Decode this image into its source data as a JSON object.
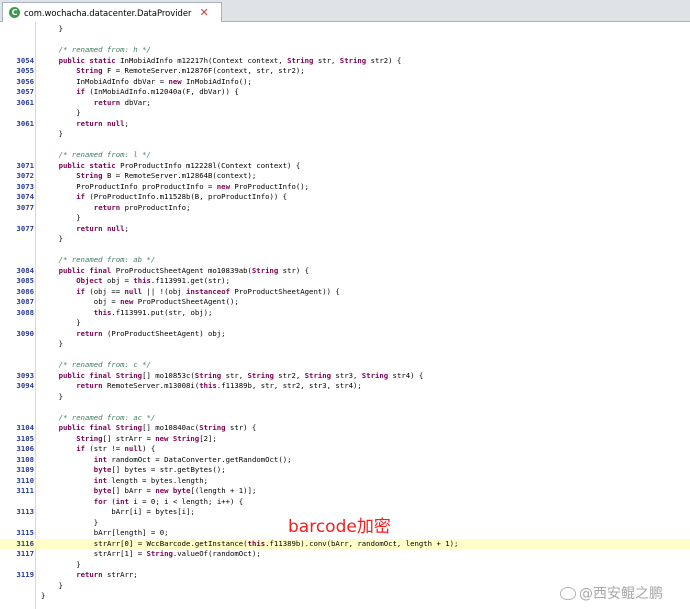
{
  "tab": {
    "title": "com.wochacha.datacenter.DataProvider",
    "icon": "class-icon",
    "close_icon": "close-icon"
  },
  "annotation": "barcode加密",
  "watermark": "@西安鲲之鹏",
  "colors": {
    "keyword": "#7f0055",
    "comment": "#3f7f5f",
    "string": "#2a00ff",
    "line_number": "#2a3a9c",
    "highlight": "#ffffc8",
    "annotation": "#ff1a1a"
  },
  "lines": [
    {
      "ln": "",
      "indent": 4,
      "tokens": [
        [
          "p",
          "}"
        ]
      ]
    },
    {
      "ln": "",
      "indent": 0,
      "tokens": []
    },
    {
      "ln": "",
      "indent": 4,
      "tokens": [
        [
          "c",
          "/* renamed from: h */"
        ]
      ]
    },
    {
      "ln": "3054",
      "indent": 4,
      "tokens": [
        [
          "k",
          "public static "
        ],
        [
          "p",
          "InMobiAdInfo m12217h(Context context, "
        ],
        [
          "k",
          "String "
        ],
        [
          "p",
          "str, "
        ],
        [
          "k",
          "String "
        ],
        [
          "p",
          "str2) {"
        ]
      ]
    },
    {
      "ln": "3055",
      "indent": 8,
      "tokens": [
        [
          "k",
          "String "
        ],
        [
          "p",
          "F = RemoteServer.m12876F(context, str, str2);"
        ]
      ]
    },
    {
      "ln": "3056",
      "indent": 8,
      "tokens": [
        [
          "p",
          "InMobiAdInfo dbVar = "
        ],
        [
          "k",
          "new "
        ],
        [
          "p",
          "InMobiAdInfo();"
        ]
      ]
    },
    {
      "ln": "3057",
      "indent": 8,
      "tokens": [
        [
          "k",
          "if "
        ],
        [
          "p",
          "(InMobiAdInfo.m12040a(F, dbVar)) {"
        ]
      ]
    },
    {
      "ln": "3061",
      "indent": 12,
      "tokens": [
        [
          "k",
          "return "
        ],
        [
          "p",
          "dbVar;"
        ]
      ]
    },
    {
      "ln": "",
      "indent": 8,
      "tokens": [
        [
          "p",
          "}"
        ]
      ]
    },
    {
      "ln": "3061",
      "indent": 8,
      "tokens": [
        [
          "k",
          "return null"
        ],
        [
          "p",
          ";"
        ]
      ]
    },
    {
      "ln": "",
      "indent": 4,
      "tokens": [
        [
          "p",
          "}"
        ]
      ]
    },
    {
      "ln": "",
      "indent": 0,
      "tokens": []
    },
    {
      "ln": "",
      "indent": 4,
      "tokens": [
        [
          "c",
          "/* renamed from: l */"
        ]
      ]
    },
    {
      "ln": "3071",
      "indent": 4,
      "tokens": [
        [
          "k",
          "public static "
        ],
        [
          "p",
          "ProProductInfo m12228l(Context context) {"
        ]
      ]
    },
    {
      "ln": "3072",
      "indent": 8,
      "tokens": [
        [
          "k",
          "String "
        ],
        [
          "p",
          "B = RemoteServer.m12864B(context);"
        ]
      ]
    },
    {
      "ln": "3073",
      "indent": 8,
      "tokens": [
        [
          "p",
          "ProProductInfo proProductInfo = "
        ],
        [
          "k",
          "new "
        ],
        [
          "p",
          "ProProductInfo();"
        ]
      ]
    },
    {
      "ln": "3074",
      "indent": 8,
      "tokens": [
        [
          "k",
          "if "
        ],
        [
          "p",
          "(ProProductInfo.m11528b(B, proProductInfo)) {"
        ]
      ]
    },
    {
      "ln": "3077",
      "indent": 12,
      "tokens": [
        [
          "k",
          "return "
        ],
        [
          "p",
          "proProductInfo;"
        ]
      ]
    },
    {
      "ln": "",
      "indent": 8,
      "tokens": [
        [
          "p",
          "}"
        ]
      ]
    },
    {
      "ln": "3077",
      "indent": 8,
      "tokens": [
        [
          "k",
          "return null"
        ],
        [
          "p",
          ";"
        ]
      ]
    },
    {
      "ln": "",
      "indent": 4,
      "tokens": [
        [
          "p",
          "}"
        ]
      ]
    },
    {
      "ln": "",
      "indent": 0,
      "tokens": []
    },
    {
      "ln": "",
      "indent": 4,
      "tokens": [
        [
          "c",
          "/* renamed from: ab */"
        ]
      ]
    },
    {
      "ln": "3084",
      "indent": 4,
      "tokens": [
        [
          "k",
          "public final "
        ],
        [
          "p",
          "ProProductSheetAgent mo10839ab("
        ],
        [
          "k",
          "String "
        ],
        [
          "p",
          "str) {"
        ]
      ]
    },
    {
      "ln": "3085",
      "indent": 8,
      "tokens": [
        [
          "k",
          "Object "
        ],
        [
          "p",
          "obj = "
        ],
        [
          "k",
          "this"
        ],
        [
          "p",
          ".f113991.get(str);"
        ]
      ]
    },
    {
      "ln": "3086",
      "indent": 8,
      "tokens": [
        [
          "k",
          "if "
        ],
        [
          "p",
          "(obj == "
        ],
        [
          "k",
          "null "
        ],
        [
          "p",
          "|| !(obj "
        ],
        [
          "k",
          "instanceof "
        ],
        [
          "p",
          "ProProductSheetAgent)) {"
        ]
      ]
    },
    {
      "ln": "3087",
      "indent": 12,
      "tokens": [
        [
          "p",
          "obj = "
        ],
        [
          "k",
          "new "
        ],
        [
          "p",
          "ProProductSheetAgent();"
        ]
      ]
    },
    {
      "ln": "3088",
      "indent": 12,
      "tokens": [
        [
          "k",
          "this"
        ],
        [
          "p",
          ".f113991.put(str, obj);"
        ]
      ]
    },
    {
      "ln": "",
      "indent": 8,
      "tokens": [
        [
          "p",
          "}"
        ]
      ]
    },
    {
      "ln": "3090",
      "indent": 8,
      "tokens": [
        [
          "k",
          "return "
        ],
        [
          "p",
          "(ProProductSheetAgent) obj;"
        ]
      ]
    },
    {
      "ln": "",
      "indent": 4,
      "tokens": [
        [
          "p",
          "}"
        ]
      ]
    },
    {
      "ln": "",
      "indent": 0,
      "tokens": []
    },
    {
      "ln": "",
      "indent": 4,
      "tokens": [
        [
          "c",
          "/* renamed from: c */"
        ]
      ]
    },
    {
      "ln": "3093",
      "indent": 4,
      "tokens": [
        [
          "k",
          "public final String"
        ],
        [
          "p",
          "[] mo10853c("
        ],
        [
          "k",
          "String "
        ],
        [
          "p",
          "str, "
        ],
        [
          "k",
          "String "
        ],
        [
          "p",
          "str2, "
        ],
        [
          "k",
          "String "
        ],
        [
          "p",
          "str3, "
        ],
        [
          "k",
          "String "
        ],
        [
          "p",
          "str4) {"
        ]
      ]
    },
    {
      "ln": "3094",
      "indent": 8,
      "tokens": [
        [
          "k",
          "return "
        ],
        [
          "p",
          "RemoteServer.m13008i("
        ],
        [
          "k",
          "this"
        ],
        [
          "p",
          ".f11389b, str, str2, str3, str4);"
        ]
      ]
    },
    {
      "ln": "",
      "indent": 4,
      "tokens": [
        [
          "p",
          "}"
        ]
      ]
    },
    {
      "ln": "",
      "indent": 0,
      "tokens": []
    },
    {
      "ln": "",
      "indent": 4,
      "tokens": [
        [
          "c",
          "/* renamed from: ac */"
        ]
      ]
    },
    {
      "ln": "3104",
      "indent": 4,
      "tokens": [
        [
          "k",
          "public final String"
        ],
        [
          "p",
          "[] mo10840ac("
        ],
        [
          "k",
          "String "
        ],
        [
          "p",
          "str) {"
        ]
      ]
    },
    {
      "ln": "3105",
      "indent": 8,
      "tokens": [
        [
          "k",
          "String"
        ],
        [
          "p",
          "[] strArr = "
        ],
        [
          "k",
          "new String"
        ],
        [
          "p",
          "[2];"
        ]
      ]
    },
    {
      "ln": "3106",
      "indent": 8,
      "tokens": [
        [
          "k",
          "if "
        ],
        [
          "p",
          "(str != "
        ],
        [
          "k",
          "null"
        ],
        [
          "p",
          ") {"
        ]
      ]
    },
    {
      "ln": "3108",
      "indent": 12,
      "tokens": [
        [
          "k",
          "int "
        ],
        [
          "p",
          "randomOct = DataConverter.getRandomOct();"
        ]
      ]
    },
    {
      "ln": "3109",
      "indent": 12,
      "tokens": [
        [
          "k",
          "byte"
        ],
        [
          "p",
          "[] bytes = str.getBytes();"
        ]
      ]
    },
    {
      "ln": "3110",
      "indent": 12,
      "tokens": [
        [
          "k",
          "int "
        ],
        [
          "p",
          "length = bytes.length;"
        ]
      ]
    },
    {
      "ln": "3111",
      "indent": 12,
      "tokens": [
        [
          "k",
          "byte"
        ],
        [
          "p",
          "[] bArr = "
        ],
        [
          "k",
          "new byte"
        ],
        [
          "p",
          "[(length + 1)];"
        ]
      ]
    },
    {
      "ln": "",
      "indent": 12,
      "tokens": [
        [
          "k",
          "for "
        ],
        [
          "p",
          "("
        ],
        [
          "k",
          "int "
        ],
        [
          "p",
          "i = 0; i < length; i++) {"
        ]
      ]
    },
    {
      "ln": "3113",
      "indent": 16,
      "tokens": [
        [
          "p",
          "bArr[i] = bytes[i];"
        ]
      ]
    },
    {
      "ln": "",
      "indent": 12,
      "tokens": [
        [
          "p",
          "}"
        ]
      ]
    },
    {
      "ln": "3115",
      "indent": 12,
      "tokens": [
        [
          "p",
          "bArr[length] = 0;"
        ]
      ]
    },
    {
      "ln": "3116",
      "indent": 12,
      "hl": true,
      "tokens": [
        [
          "p",
          "strArr[0] = WccBarcode.getInstance("
        ],
        [
          "k",
          "this"
        ],
        [
          "p",
          ".f11389b).conv(bArr, randomOct, length + 1);"
        ]
      ]
    },
    {
      "ln": "3117",
      "indent": 12,
      "tokens": [
        [
          "p",
          "strArr[1] = "
        ],
        [
          "k",
          "String"
        ],
        [
          "p",
          ".valueOf(randomOct);"
        ]
      ]
    },
    {
      "ln": "",
      "indent": 8,
      "tokens": [
        [
          "p",
          "}"
        ]
      ]
    },
    {
      "ln": "3119",
      "indent": 8,
      "tokens": [
        [
          "k",
          "return "
        ],
        [
          "p",
          "strArr;"
        ]
      ]
    },
    {
      "ln": "",
      "indent": 4,
      "tokens": [
        [
          "p",
          "}"
        ]
      ]
    },
    {
      "ln": "",
      "indent": 0,
      "tokens": [
        [
          "p",
          "}"
        ]
      ]
    }
  ]
}
